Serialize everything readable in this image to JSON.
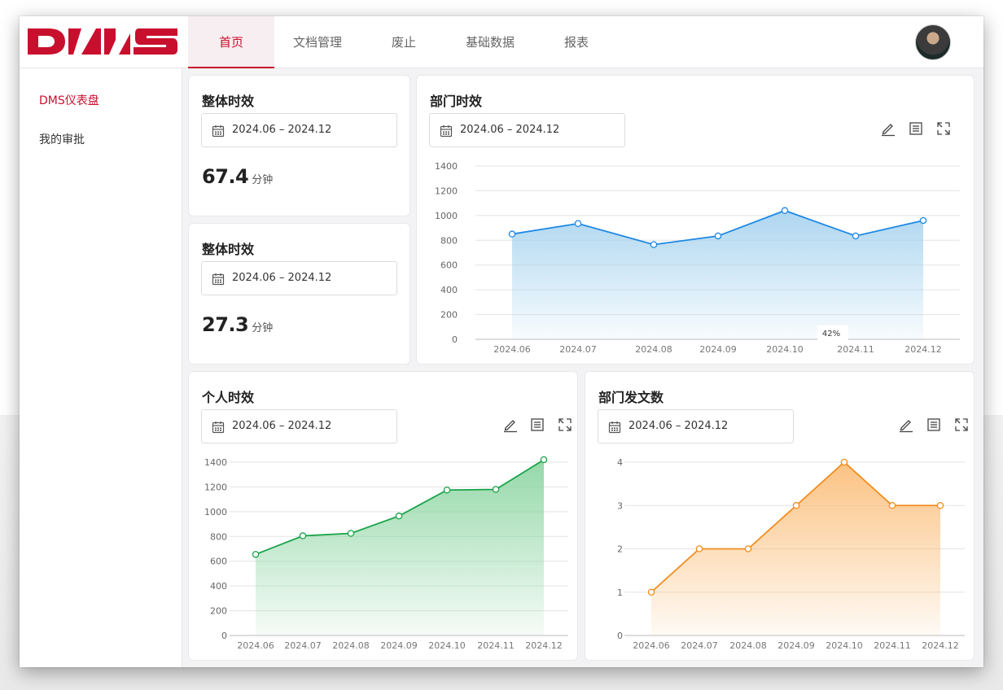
{
  "header": {
    "logo_text": "DMS",
    "brand_color": "#c8102e",
    "nav": [
      "首页",
      "文档管理",
      "废止",
      "基础数据",
      "报表"
    ],
    "active_nav": 0
  },
  "sidebar": {
    "items": [
      {
        "label": "DMS仪表盘",
        "active": true
      },
      {
        "label": "我的审批",
        "active": false
      }
    ]
  },
  "cards": {
    "overall1": {
      "title": "整体时效",
      "date_range": "2024.06 – 2024.12",
      "value": "67.4",
      "unit": "分钟"
    },
    "overall2": {
      "title": "整体时效",
      "date_range": "2024.06 – 2024.12",
      "value": "27.3",
      "unit": "分钟"
    },
    "dept": {
      "title": "部门时效",
      "date_range": "2024.06 – 2024.12"
    },
    "personal": {
      "title": "个人时效",
      "date_range": "2024.06 – 2024.12"
    },
    "dept_docs": {
      "title": "部门发文数",
      "date_range": "2024.06 – 2024.12"
    }
  },
  "tool_icons": [
    "edit-icon",
    "table-icon",
    "fullscreen-icon"
  ],
  "chart_data": [
    {
      "id": "dept",
      "type": "area",
      "x": [
        "2024.06",
        "2024.07",
        "2024.08",
        "2024.09",
        "2024.10",
        "2024.11",
        "2024.12"
      ],
      "values": [
        850,
        935,
        765,
        835,
        1040,
        835,
        960
      ],
      "ylim": [
        0,
        1400
      ],
      "yticks": [
        0,
        200,
        400,
        600,
        800,
        1000,
        1200,
        1400
      ],
      "color": "#1e88e5",
      "fill_color": "#a9d4ef",
      "grid": true,
      "annotation": "42%"
    },
    {
      "id": "personal",
      "type": "area",
      "x": [
        "2024.06",
        "2024.07",
        "2024.08",
        "2024.09",
        "2024.10",
        "2024.11",
        "2024.12"
      ],
      "values": [
        655,
        805,
        825,
        965,
        1175,
        1180,
        1420
      ],
      "ylim": [
        0,
        1400
      ],
      "yticks": [
        0,
        200,
        400,
        600,
        800,
        1000,
        1200,
        1400
      ],
      "color": "#1aa34a",
      "fill_color": "#8fd6a4",
      "grid": true
    },
    {
      "id": "dept_docs",
      "type": "area",
      "x": [
        "2024.06",
        "2024.07",
        "2024.08",
        "2024.09",
        "2024.10",
        "2024.11",
        "2024.12"
      ],
      "values": [
        1,
        2,
        2,
        3,
        4,
        3,
        3
      ],
      "ylim": [
        0,
        4
      ],
      "yticks": [
        0,
        1,
        2,
        3,
        4
      ],
      "color": "#f28c1c",
      "fill_color": "#fbbf7c",
      "grid": true
    }
  ]
}
